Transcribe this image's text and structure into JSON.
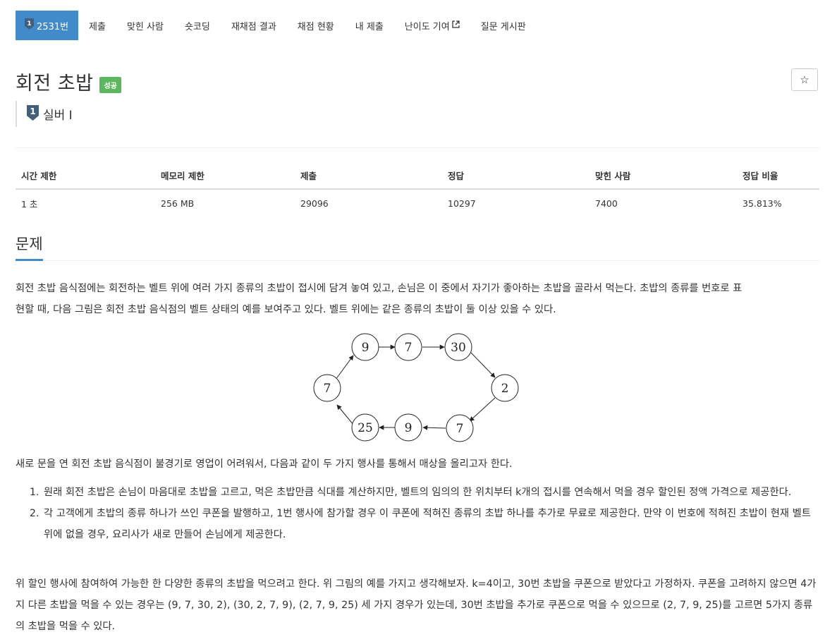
{
  "nav": {
    "problem_number": "2531번",
    "tier_number": "1",
    "items": [
      "제출",
      "맞힌 사람",
      "숏코딩",
      "재채점 결과",
      "채점 현황",
      "내 제출",
      "난이도 기여",
      "질문 게시판"
    ]
  },
  "problem": {
    "title": "회전 초밥",
    "status": "성공",
    "tier_number": "1",
    "tier_label": "실버 I",
    "star": "☆"
  },
  "info_table": {
    "headers": [
      "시간 제한",
      "메모리 제한",
      "제출",
      "정답",
      "맞힌 사람",
      "정답 비율"
    ],
    "values": [
      "1 초",
      "256 MB",
      "29096",
      "10297",
      "7400",
      "35.813%"
    ]
  },
  "section": {
    "title": "문제",
    "para1_line1": "회전 초밥 음식점에는 회전하는 벨트 위에 여러 가지 종류의 초밥이 접시에 담겨 놓여 있고, 손님은 이 중에서 자기가 좋아하는 초밥을 골라서 먹는다. 초밥의 종류를 번호로 표",
    "para1_line2": "현할 때, 다음 그림은 회전 초밥 음식점의 벨트 상태의 예를 보여주고 있다. 벨트 위에는 같은 종류의 초밥이 둘 이상 있을 수 있다.",
    "para2": "새로 문을 연 회전 초밥 음식점이 불경기로 영업이 어려워서, 다음과 같이 두 가지 행사를 통해서 매상을 올리고자 한다.",
    "rules": [
      "원래 회전 초밥은 손님이 마음대로 초밥을 고르고, 먹은 초밥만큼 식대를 계산하지만, 벨트의 임의의 한 위치부터 k개의 접시를 연속해서 먹을 경우 할인된 정액 가격으로 제공한다.",
      "각 고객에게 초밥의 종류 하나가 쓰인 쿠폰을 발행하고, 1번 행사에 참가할 경우 이 쿠폰에 적혀진 종류의 초밥 하나를 추가로 무료로 제공한다. 만약 이 번호에 적혀진 초밥이 현재 벨트 위에 없을 경우, 요리사가 새로 만들어 손님에게 제공한다."
    ],
    "para3": "위 할인 행사에 참여하여 가능한 한 다양한 종류의 초밥을 먹으려고 한다. 위 그림의 예를 가지고 생각해보자. k=4이고, 30번 초밥을 쿠폰으로 받았다고 가정하자. 쿠폰을 고려하지 않으면 4가지 다른 초밥을 먹을 수 있는 경우는 (9, 7, 30, 2), (30, 2, 7, 9), (2, 7, 9, 25) 세 가지 경우가 있는데, 30번 초밥을 추가로 쿠폰으로 먹을 수 있으므로 (2, 7, 9, 25)를 고르면 5가지 종류의 초밥을 먹을 수 있다."
  },
  "figure": {
    "belt": [
      "9",
      "7",
      "30",
      "2",
      "7",
      "9",
      "25",
      "7"
    ]
  },
  "colors": {
    "nav_active": "#428bca",
    "status_success": "#5cb85c",
    "tier_silver": "#435f7a"
  }
}
